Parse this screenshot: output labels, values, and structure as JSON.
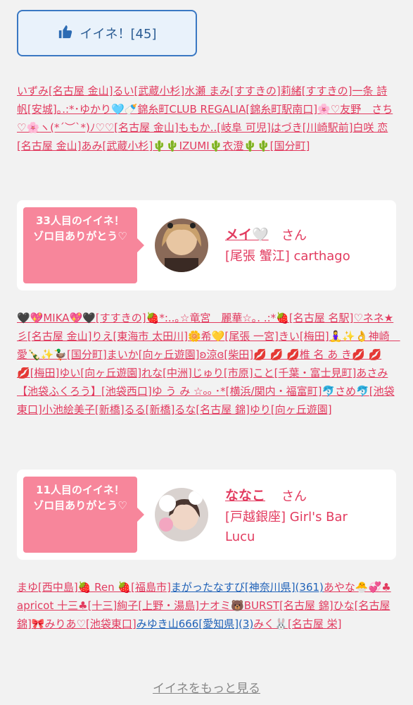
{
  "like_button": {
    "label": "イイネ！[45]",
    "icon": "thumbs-up-icon"
  },
  "section1": [
    {
      "t": "いずみ"
    },
    {
      "t": "[名古屋 金山]"
    },
    {
      "t": "るい"
    },
    {
      "t": "[武蔵小杉]"
    },
    {
      "t": "水瀬 まみ"
    },
    {
      "t": "[すすきの]"
    },
    {
      "t": "莉緒"
    },
    {
      "t": "[すすきの]"
    },
    {
      "t": "一条 詩帆"
    },
    {
      "t": "[安城]"
    },
    {
      "t": "｡.:*･ゆかり🩵🍼"
    },
    {
      "t": "錦糸町CLUB REGALIA"
    },
    {
      "t": "[錦糸町駅南口]"
    },
    {
      "t": "🌸♡友野　さち♡🌸"
    },
    {
      "t": "ヽ(*´︶`*)ﾉ♡♡"
    },
    {
      "t": "[名古屋 金山]"
    },
    {
      "t": "ももか.."
    },
    {
      "t": "[岐阜 可児]"
    },
    {
      "t": "はづき"
    },
    {
      "t": "[川崎駅前]"
    },
    {
      "t": "白咲 恋"
    },
    {
      "t": "[名古屋 金山]"
    },
    {
      "t": "あみ"
    },
    {
      "t": "[武蔵小杉]"
    },
    {
      "t": "🌵🌵IZUMI🌵"
    },
    {
      "t": "衣澄🌵🌵"
    },
    {
      "t": "[国分町]"
    }
  ],
  "card1": {
    "badge": "33人目のイイネ！\nゾロ目ありがとう♡",
    "name": "メイ🤍",
    "san": "さん",
    "store": "[尾張 蟹江] carthago"
  },
  "section2": [
    {
      "t": "🖤💖MIKA💖🖤"
    },
    {
      "t": "[すすきの]"
    },
    {
      "t": "🍓*:..｡☆竜宮　麗華☆｡. .:*🍓"
    },
    {
      "t": "[名古屋 名駅]"
    },
    {
      "t": "♡ネネ★彡"
    },
    {
      "t": "[名古屋 金山]"
    },
    {
      "t": "りえ"
    },
    {
      "t": "[東海市 太田川]"
    },
    {
      "t": "🌼希💛"
    },
    {
      "t": "[尾張 一宮]"
    },
    {
      "t": "きい"
    },
    {
      "t": "[梅田]"
    },
    {
      "t": "🧘‍♀️✨👌神崎　愛🍾✨🦆"
    },
    {
      "t": "[国分町]"
    },
    {
      "t": "まいか"
    },
    {
      "t": "[向ヶ丘遊園]"
    },
    {
      "t": "ʚ涼ɞ"
    },
    {
      "t": "[柴田]"
    },
    {
      "t": "💋 💋 💋椎 名 あ き💋 💋 💋"
    },
    {
      "t": "[梅田]"
    },
    {
      "t": "ゆい"
    },
    {
      "t": "[向ヶ丘遊園]"
    },
    {
      "t": "れな"
    },
    {
      "t": "[中洲]"
    },
    {
      "t": "じゅり"
    },
    {
      "t": "[市原]"
    },
    {
      "t": "こと"
    },
    {
      "t": "[千葉・富士見町]"
    },
    {
      "t": "あさみ【池袋ふくろう】"
    },
    {
      "t": "[池袋西口]"
    },
    {
      "t": "ゆ う み ☆ₒₒ ･*"
    },
    {
      "t": "[横浜/関内・福富町]"
    },
    {
      "t": "🐬さめ🐬"
    },
    {
      "t": "[池袋東口]"
    },
    {
      "t": "小池絵美子"
    },
    {
      "t": "[新橋]"
    },
    {
      "t": "るる"
    },
    {
      "t": "[新橋]"
    },
    {
      "t": "るな"
    },
    {
      "t": "[名古屋 錦]"
    },
    {
      "t": "ゆり"
    },
    {
      "t": "[向ヶ丘遊園]"
    }
  ],
  "card2": {
    "badge": "11人目のイイネ！\nゾロ目ありがとう♡",
    "name": "ななこ",
    "san": "さん",
    "store_line1": "[戸越銀座] Girl's Bar",
    "store_line2": "Lucu"
  },
  "section3": [
    {
      "t": "まゆ"
    },
    {
      "t": "[西中島]"
    },
    {
      "t": "🍓 Ren 🍓"
    },
    {
      "t": "[福島市]"
    },
    {
      "t": "まがったなすび",
      "c": "blue"
    },
    {
      "t": "[神奈川県](361)",
      "c": "blue"
    },
    {
      "t": "あやな🐣💞"
    },
    {
      "t": "♣apricot 十三♣"
    },
    {
      "t": "[十三]"
    },
    {
      "t": "絢子"
    },
    {
      "t": "[上野・湯島]"
    },
    {
      "t": "ナオミ🐻BURST"
    },
    {
      "t": "[名古屋 錦]"
    },
    {
      "t": "ひな"
    },
    {
      "t": "[名古屋 錦]"
    },
    {
      "t": "🎀みりあ♡"
    },
    {
      "t": "[池袋東口]"
    },
    {
      "t": "みゆき山666",
      "c": "blue"
    },
    {
      "t": "[愛知県](3)",
      "c": "blue"
    },
    {
      "t": "みく🐰"
    },
    {
      "t": "[名古屋 栄]"
    }
  ],
  "more_link": "イイネをもっと見る",
  "colors": {
    "accent": "#e23b5f",
    "badge": "#f7869b",
    "link_blue": "#2062b8"
  }
}
